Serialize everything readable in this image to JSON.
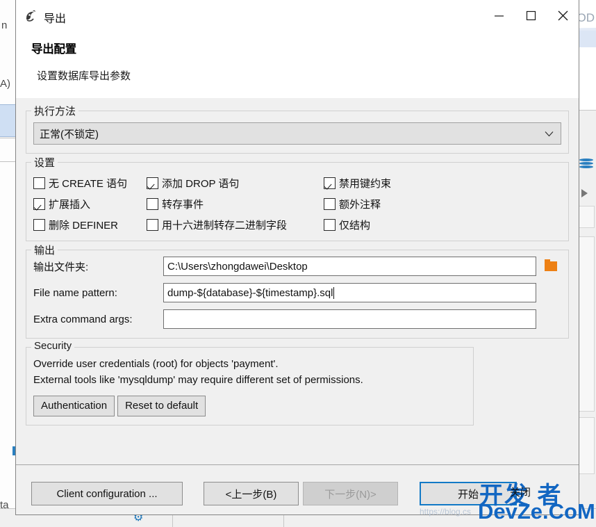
{
  "window": {
    "title": "导出",
    "icon": "dolphin-icon",
    "controls": {
      "minimize": "minimize-icon",
      "maximize": "maximize-icon",
      "close": "close-icon"
    }
  },
  "header": {
    "title": "导出配置",
    "subtitle": "设置数据库导出参数"
  },
  "execution": {
    "legend": "执行方法",
    "selected": "正常(不锁定)"
  },
  "settings": {
    "legend": "设置",
    "checkboxes": [
      {
        "label": "无 CREATE 语句",
        "checked": false
      },
      {
        "label": "添加 DROP 语句",
        "checked": true
      },
      {
        "label": "禁用键约束",
        "checked": true
      },
      {
        "label": "扩展插入",
        "checked": true
      },
      {
        "label": "转存事件",
        "checked": false
      },
      {
        "label": "额外注释",
        "checked": false
      },
      {
        "label": "删除 DEFINER",
        "checked": false
      },
      {
        "label": "用十六进制转存二进制字段",
        "checked": false
      },
      {
        "label": "仅结构",
        "checked": false
      }
    ]
  },
  "output": {
    "legend": "输出",
    "folder_label": "输出文件夹:",
    "folder_value": "C:\\Users\\zhongdawei\\Desktop",
    "browse_icon": "folder-icon",
    "pattern_label": "File name pattern:",
    "pattern_value": "dump-${database}-${timestamp}.sql",
    "extra_label": "Extra command args:",
    "extra_value": ""
  },
  "security": {
    "legend": "Security",
    "line1": "Override user credentials (root) for objects 'payment'.",
    "line2": "External tools like 'mysqldump' may require different set of permissions.",
    "auth_button": "Authentication",
    "reset_button": "Reset to default"
  },
  "footer": {
    "client_config": "Client configuration ...",
    "back": "<上一步(B)",
    "next": "下一步(N)>",
    "start": "开始",
    "start_accent": "#1279c6"
  },
  "watermark": {
    "top": "开发 者",
    "bottom": "DevZe.CoM",
    "small": "关闭",
    "url": "https://blog.cs"
  },
  "background": {
    "right_text": "OD",
    "left_text_a": "A)",
    "left_text_b": "n",
    "left_text_c": "ta"
  }
}
